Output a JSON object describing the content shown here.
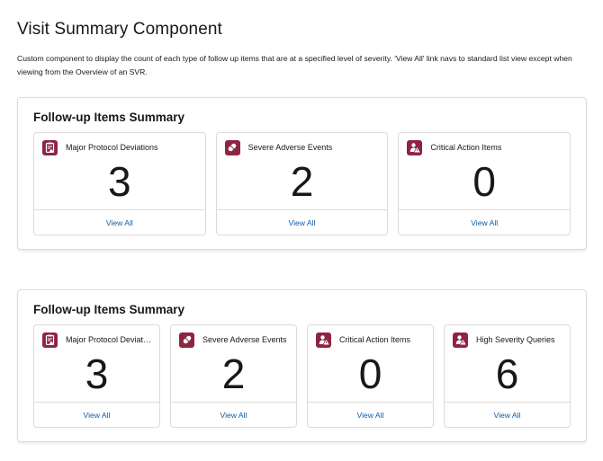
{
  "page": {
    "title": "Visit Summary Component",
    "description": "Custom component to display the count of each type of follow up items that are at a specified level of severity. 'View All' link navs to standard list view except when viewing from the Overview of an SVR."
  },
  "colors": {
    "icon_bg": "#8e2443",
    "link": "#0b5cab",
    "border": "#dddbda"
  },
  "panels": [
    {
      "title": "Follow-up Items Summary",
      "cards": [
        {
          "label": "Major Protocol Deviations",
          "count": "3",
          "link": "View All",
          "icon": "clipboard-warning-icon"
        },
        {
          "label": "Severe Adverse Events",
          "count": "2",
          "link": "View All",
          "icon": "pill-icon"
        },
        {
          "label": "Critical Action Items",
          "count": "0",
          "link": "View All",
          "icon": "person-warning-icon"
        }
      ]
    },
    {
      "title": "Follow-up Items Summary",
      "cards": [
        {
          "label": "Major Protocol Deviations",
          "count": "3",
          "link": "View All",
          "icon": "clipboard-warning-icon"
        },
        {
          "label": "Severe Adverse Events",
          "count": "2",
          "link": "View All",
          "icon": "pill-icon"
        },
        {
          "label": "Critical Action Items",
          "count": "0",
          "link": "View All",
          "icon": "person-warning-icon"
        },
        {
          "label": "High Severity Queries",
          "count": "6",
          "link": "View All",
          "icon": "person-warning-icon"
        }
      ]
    }
  ]
}
